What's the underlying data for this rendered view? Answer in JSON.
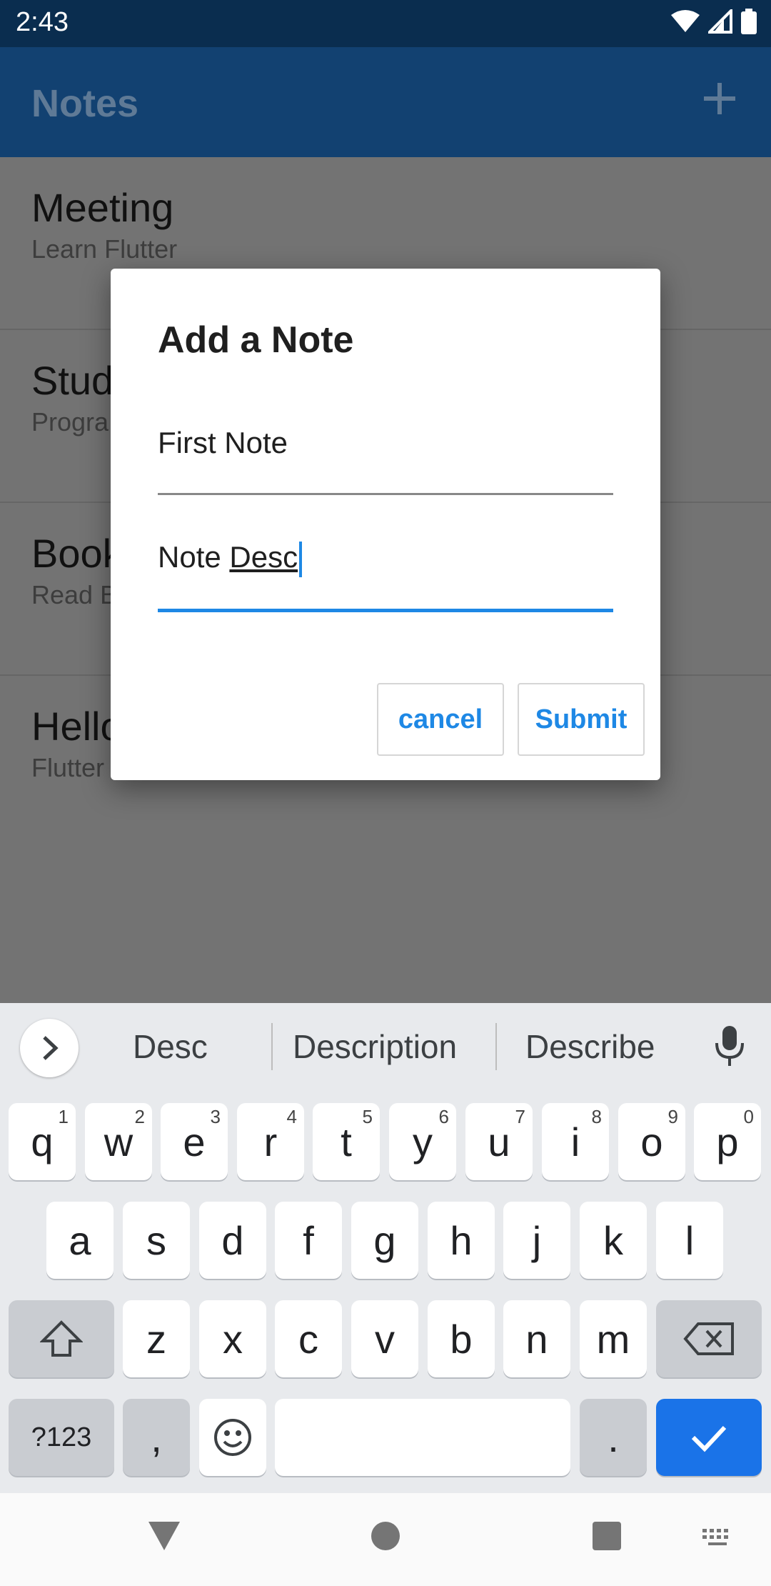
{
  "status": {
    "time": "2:43"
  },
  "appbar": {
    "title": "Notes"
  },
  "notes": [
    {
      "title": "Meeting",
      "subtitle": "Learn Flutter"
    },
    {
      "title": "Stud",
      "subtitle": "Progra"
    },
    {
      "title": "Book",
      "subtitle": "Read B"
    },
    {
      "title": "Hello",
      "subtitle": "Flutter"
    }
  ],
  "dialog": {
    "title": "Add a Note",
    "field1": "First Note",
    "field2_prefix": "Note ",
    "field2_word": "Desc",
    "cancel": "cancel",
    "submit": "Submit"
  },
  "keyboard": {
    "suggestions": [
      "Desc",
      "Description",
      "Describe"
    ],
    "row1": [
      {
        "k": "q",
        "n": "1"
      },
      {
        "k": "w",
        "n": "2"
      },
      {
        "k": "e",
        "n": "3"
      },
      {
        "k": "r",
        "n": "4"
      },
      {
        "k": "t",
        "n": "5"
      },
      {
        "k": "y",
        "n": "6"
      },
      {
        "k": "u",
        "n": "7"
      },
      {
        "k": "i",
        "n": "8"
      },
      {
        "k": "o",
        "n": "9"
      },
      {
        "k": "p",
        "n": "0"
      }
    ],
    "row2": [
      "a",
      "s",
      "d",
      "f",
      "g",
      "h",
      "j",
      "k",
      "l"
    ],
    "row3": [
      "z",
      "x",
      "c",
      "v",
      "b",
      "n",
      "m"
    ],
    "symbols": "?123",
    "comma": ",",
    "period": "."
  },
  "colors": {
    "primary": "#1e88e5",
    "appbar": "#124171",
    "enter": "#1a73e8"
  }
}
